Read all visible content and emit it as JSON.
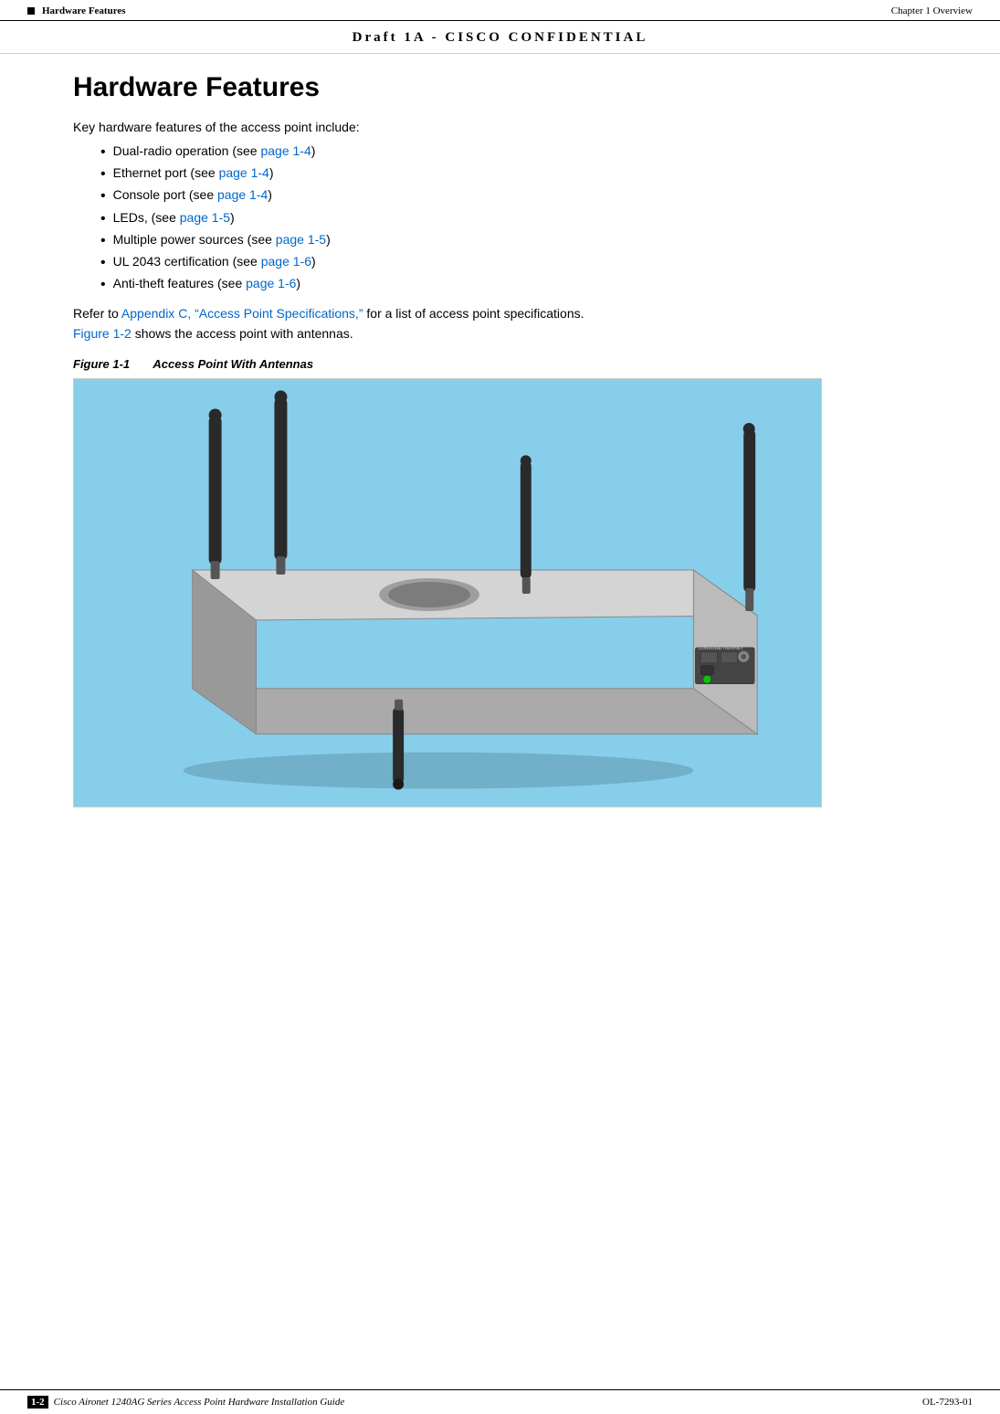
{
  "header": {
    "section_label": "Hardware Features",
    "chapter_text": "Chapter 1      Overview"
  },
  "draft_banner": "Draft  1A  -  CISCO  CONFIDENTIAL",
  "page_title": "Hardware Features",
  "intro_text": "Key hardware features of the access point include:",
  "bullets": [
    {
      "text": "Dual-radio operation (see ",
      "link": "page 1-4",
      "suffix": ")"
    },
    {
      "text": "Ethernet port (see ",
      "link": "page 1-4",
      "suffix": ")"
    },
    {
      "text": "Console port (see ",
      "link": "page 1-4",
      "suffix": ")"
    },
    {
      "text": "LEDs, (see ",
      "link": "page 1-5",
      "suffix": ")"
    },
    {
      "text": "Multiple power sources (see ",
      "link": "page 1-5",
      "suffix": ")"
    },
    {
      "text": "UL 2043 certification (see ",
      "link": "page 1-6",
      "suffix": ")"
    },
    {
      "text": "Anti-theft features (see ",
      "link": "page 1-6",
      "suffix": ")"
    }
  ],
  "refer_text_before_link": "Refer to ",
  "refer_link": "Appendix C, “Access Point Specifications,”",
  "refer_text_after_link": " for a list of access point specifications.",
  "figure_ref_before": "",
  "figure_ref_link": "Figure 1-2",
  "figure_ref_after": " shows the access point with antennas.",
  "figure_caption_label": "Figure 1-1",
  "figure_caption_title": "Access Point With Antennas",
  "footer": {
    "page_num": "1-2",
    "guide_title": "Cisco Aironet 1240AG Series Access Point Hardware Installation Guide",
    "doc_num": "OL-7293-01"
  }
}
